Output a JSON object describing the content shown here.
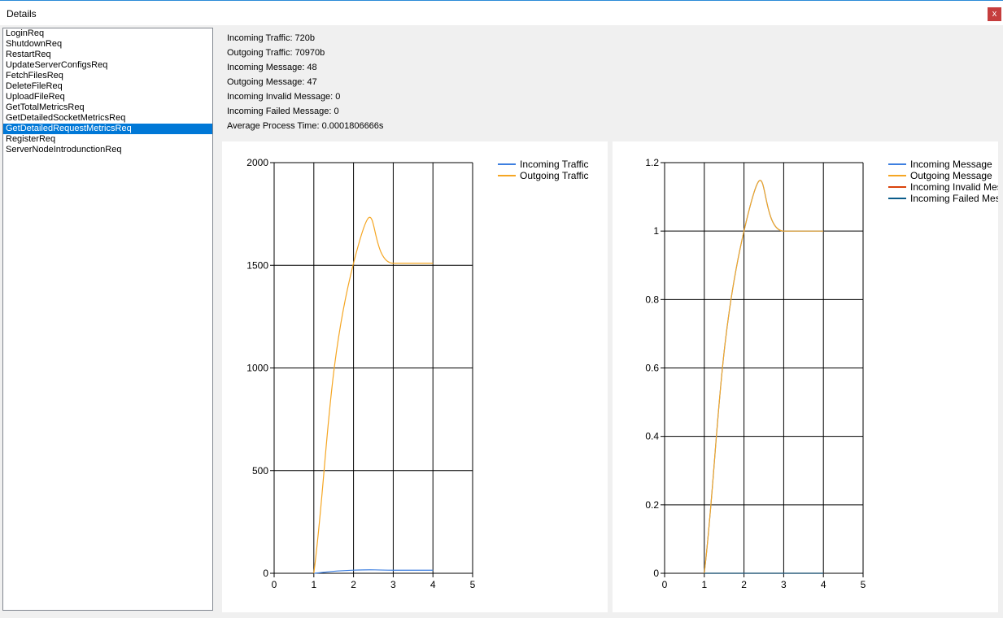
{
  "window": {
    "title": "Details",
    "close_label": "x"
  },
  "requests": {
    "items": [
      "LoginReq",
      "ShutdownReq",
      "RestartReq",
      "UpdateServerConfigsReq",
      "FetchFilesReq",
      "DeleteFileReq",
      "UploadFileReq",
      "GetTotalMetricsReq",
      "GetDetailedSocketMetricsReq",
      "GetDetailedRequestMetricsReq",
      "RegisterReq",
      "ServerNodeIntrodunctionReq"
    ],
    "selected_index": 9
  },
  "stats": {
    "incoming_traffic": "Incoming Traffic: 720b",
    "outgoing_traffic": "Outgoing Traffic: 70970b",
    "incoming_message": "Incoming Message: 48",
    "outgoing_message": "Outgoing Message: 47",
    "incoming_invalid": "Incoming Invalid Message: 0",
    "incoming_failed": "Incoming Failed Message: 0",
    "avg_process_time": "Average Process Time: 0.0001806666s"
  },
  "chart_data": [
    {
      "type": "line",
      "xlim": [
        0,
        5
      ],
      "ylim": [
        0,
        2000
      ],
      "x_ticks": [
        "0",
        "1",
        "2",
        "3",
        "4",
        "5"
      ],
      "y_ticks": [
        "0",
        "500",
        "1000",
        "1500",
        "2000"
      ],
      "grid": true,
      "legend_position": "top-right",
      "series": [
        {
          "name": "Incoming Traffic",
          "color": "#3d7fe0",
          "x": [
            1,
            2,
            3,
            4
          ],
          "y": [
            0,
            15,
            15,
            15
          ]
        },
        {
          "name": "Outgoing Traffic",
          "color": "#f5a623",
          "x": [
            1,
            2,
            3,
            4
          ],
          "y": [
            0,
            1510,
            1510,
            1510
          ]
        }
      ]
    },
    {
      "type": "line",
      "xlim": [
        0,
        5
      ],
      "ylim": [
        0,
        1.2
      ],
      "x_ticks": [
        "0",
        "1",
        "2",
        "3",
        "4",
        "5"
      ],
      "y_ticks": [
        "0",
        "0.2",
        "0.4",
        "0.6",
        "0.8",
        "1",
        "1.2"
      ],
      "grid": true,
      "legend_position": "top-right",
      "series": [
        {
          "name": "Incoming Message",
          "color": "#3d7fe0",
          "x": [
            1,
            2,
            3,
            4
          ],
          "y": [
            0,
            1,
            1,
            1
          ]
        },
        {
          "name": "Outgoing Message",
          "color": "#f5a623",
          "x": [
            1,
            2,
            3,
            4
          ],
          "y": [
            0,
            1,
            1,
            1
          ]
        },
        {
          "name": "Incoming Invalid Message",
          "color": "#d9420b",
          "x": [
            1,
            2,
            3,
            4
          ],
          "y": [
            0,
            0,
            0,
            0
          ]
        },
        {
          "name": "Incoming Failed Message",
          "color": "#0b5c8a",
          "x": [
            1,
            2,
            3,
            4
          ],
          "y": [
            0,
            0,
            0,
            0
          ]
        }
      ]
    }
  ]
}
